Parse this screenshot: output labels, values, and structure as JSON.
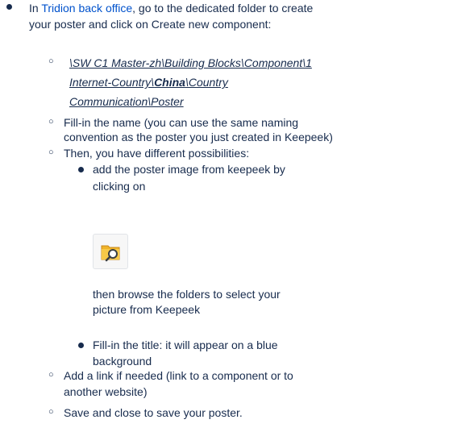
{
  "step": {
    "prefix": "In ",
    "link_text": "Tridion back office",
    "rest_line1": ", go to the dedicated folder to create",
    "line2": "your poster and click on Create new component:"
  },
  "path": {
    "line1": "\\SW C1 Master-zh\\Building Blocks\\Component\\1",
    "line2_a": "Internet-Country\\",
    "line2_bold": "China",
    "line2_b": "\\Country",
    "line3": "Communication\\Poster"
  },
  "fill_name": {
    "line1": "Fill-in the name (you can use the same naming",
    "line2": "convention as the poster you just created in Keepeek)"
  },
  "then": "Then, you have different possibilities:",
  "add_image": {
    "line1": "add the poster image from keepeek by",
    "line2": "clicking on",
    "after1": "then browse the folders to select your",
    "after2": "picture from Keepeek"
  },
  "fill_title": {
    "line1": "Fill-in the title: it will appear on a blue",
    "line2": "background"
  },
  "add_link": {
    "line1": "Add a link if needed (link to a component or to",
    "line2": "another website)"
  },
  "save": "Save and close to save your poster.",
  "icon": "keepeek-browse-folder-icon"
}
